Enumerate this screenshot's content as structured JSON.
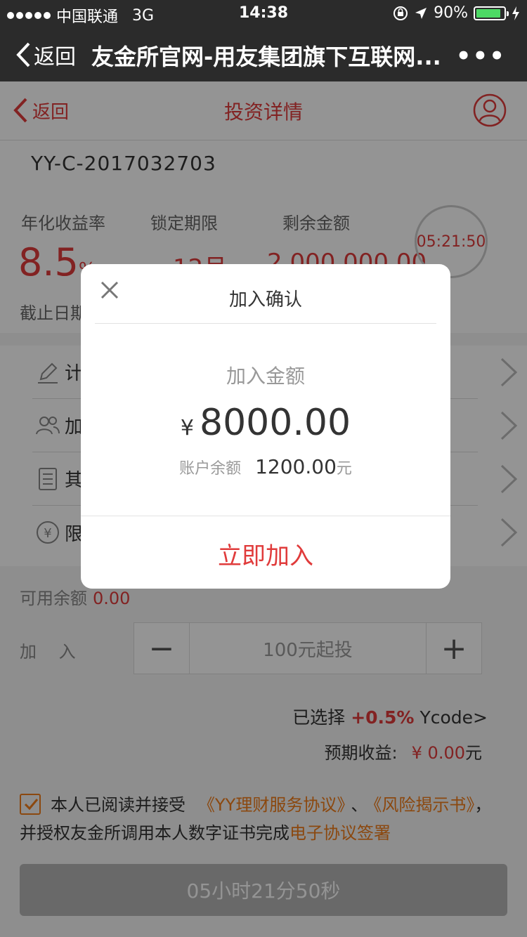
{
  "status_bar": {
    "carrier": "中国联通",
    "network": "3G",
    "time": "14:38",
    "battery": "90%"
  },
  "wechat_nav": {
    "back_label": "返回",
    "title": "友金所官网-用友集团旗下互联网...",
    "more": "•••"
  },
  "header": {
    "back_label": "返回",
    "title": "投资详情"
  },
  "product": {
    "code": "YY-C-2017032703",
    "labels": {
      "rate": "年化收益率",
      "term": "锁定期限",
      "remaining": "剩余金额"
    },
    "rate_value": "8.5",
    "rate_unit": "%",
    "term_value": "12月",
    "remaining_value": "2,000,000.00",
    "deadline_label": "截止日期",
    "countdown": "05:21:50"
  },
  "menu": {
    "items": [
      {
        "label": "计",
        "icon": "pencil-icon"
      },
      {
        "label": "加",
        "icon": "users-icon"
      },
      {
        "label": "其",
        "icon": "document-icon"
      },
      {
        "label": "限",
        "icon": "yen-icon"
      }
    ]
  },
  "purchase": {
    "available_label": "可用余额",
    "available_value": "0.00",
    "join_label": "加 入",
    "minus": "−",
    "plus": "+",
    "placeholder": "100元起投",
    "selected_label": "已选择",
    "selected_bonus": "+0.5%",
    "ycode_link": "Ycode>",
    "expected_label": "预期收益:",
    "expected_value": "¥ 0.00",
    "expected_unit": "元"
  },
  "agreement": {
    "prefix": "本人已阅读并接受",
    "link1": "《YY理财服务协议》",
    "sep": "、",
    "link2": "《风险揭示书》",
    "middle": "，并授权友金所调用本人数字证书完成",
    "link3": "电子协议签署"
  },
  "submit": {
    "label": "05小时21分50秒"
  },
  "modal": {
    "title": "加入确认",
    "amount_label": "加入金额",
    "currency": "¥",
    "amount": "8000.00",
    "balance_label": "账户余额",
    "balance_value": "1200.00",
    "balance_unit": "元",
    "confirm_label": "立即加入"
  },
  "colors": {
    "accent": "#e03b3b",
    "link": "#f07d1a",
    "nav_bg": "#2b2b2b",
    "disabled": "#b5b5b5"
  }
}
